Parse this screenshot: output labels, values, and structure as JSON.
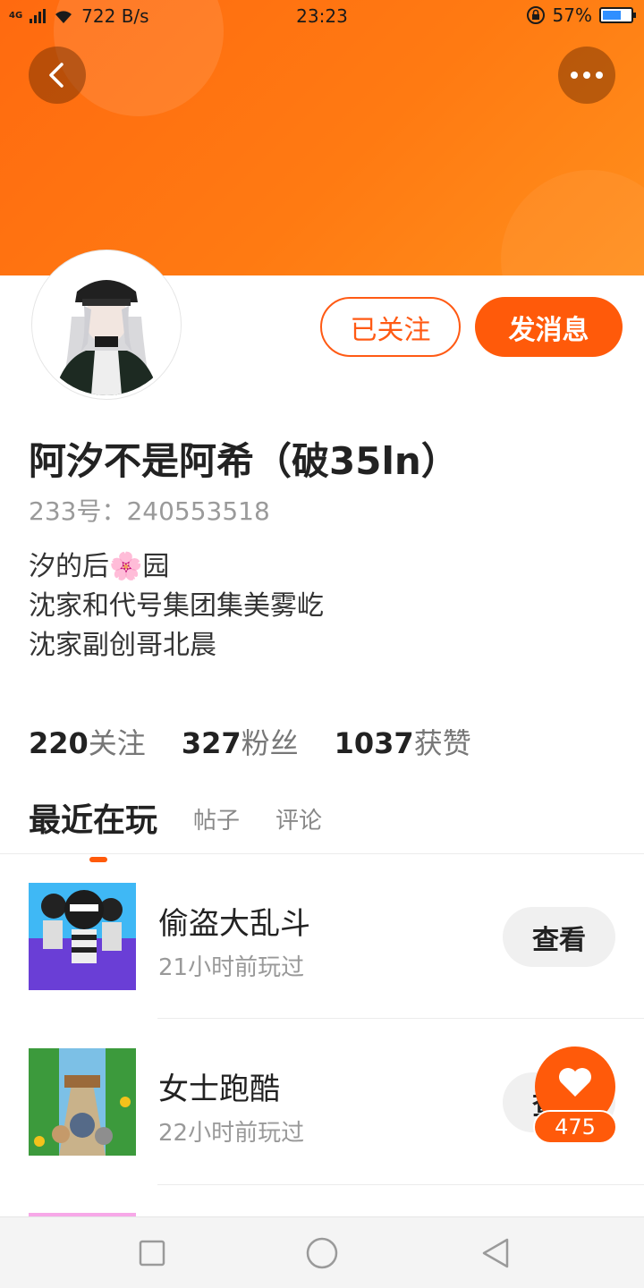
{
  "status_bar": {
    "network": "4G",
    "speed": "722 B/s",
    "time": "23:23",
    "battery": "57%",
    "battery_level": 0.57
  },
  "header": {
    "back_icon": "chevron-left-icon",
    "more_icon": "more-horizontal-icon",
    "colors": {
      "accent": "#ff5a0a",
      "banner": "#ff7a12"
    }
  },
  "profile": {
    "follow_label": "已关注",
    "message_label": "发消息",
    "username": "阿汐不是阿希（破35ln）",
    "user_id": "233号：240553518",
    "bio_lines": [
      "汐的后🌸园",
      "沈家和代号集团集美雾屹",
      "沈家副创哥北晨"
    ]
  },
  "stats": [
    {
      "value": "220",
      "label": "关注"
    },
    {
      "value": "327",
      "label": "粉丝"
    },
    {
      "value": "1037",
      "label": "获赞"
    }
  ],
  "tabs": [
    "最近在玩",
    "帖子",
    "评论"
  ],
  "games": [
    {
      "name": "偷盗大乱斗",
      "played": "21小时前玩过",
      "action": "查看"
    },
    {
      "name": "女士跑酷",
      "played": "22小时前玩过",
      "action": "查看"
    }
  ],
  "like_float": {
    "count": "475",
    "icon": "heart-icon"
  },
  "nav_bar": {
    "items": [
      "square-icon",
      "circle-icon",
      "triangle-back-icon"
    ]
  }
}
